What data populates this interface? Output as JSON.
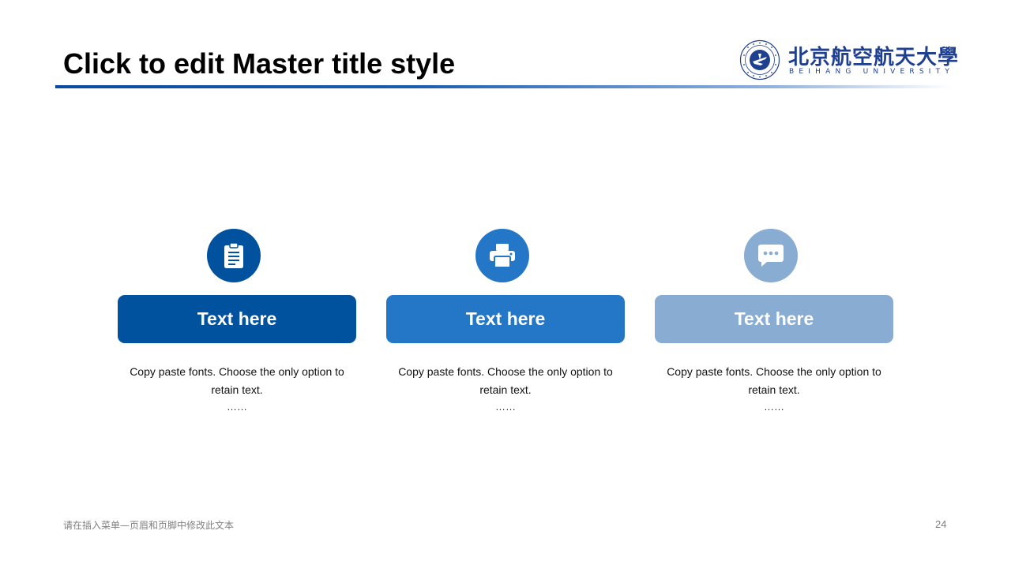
{
  "slide": {
    "title": "Click to edit Master title style",
    "footer_text": "请在插入菜单—页眉和页脚中修改此文本",
    "page_number": "24"
  },
  "logo": {
    "name_cn": "北京航空航天大學",
    "name_en": "BEIHANG UNIVERSITY"
  },
  "cards": [
    {
      "icon": "clipboard-icon",
      "heading": "Text here",
      "description": "Copy paste fonts. Choose the only option to retain text.",
      "ellipsis": "……",
      "color": "#00529f"
    },
    {
      "icon": "printer-icon",
      "heading": "Text here",
      "description": "Copy paste fonts. Choose the only option to retain text.",
      "ellipsis": "……",
      "color": "#2476c6"
    },
    {
      "icon": "chat-bubble-icon",
      "heading": "Text here",
      "description": "Copy paste fonts. Choose the only option to retain text.",
      "ellipsis": "……",
      "color": "#88acd2"
    }
  ],
  "colors": {
    "title_line_start": "#0a4aa0",
    "logo_blue": "#1f3f8f",
    "footer_gray": "#7f7f7f"
  }
}
